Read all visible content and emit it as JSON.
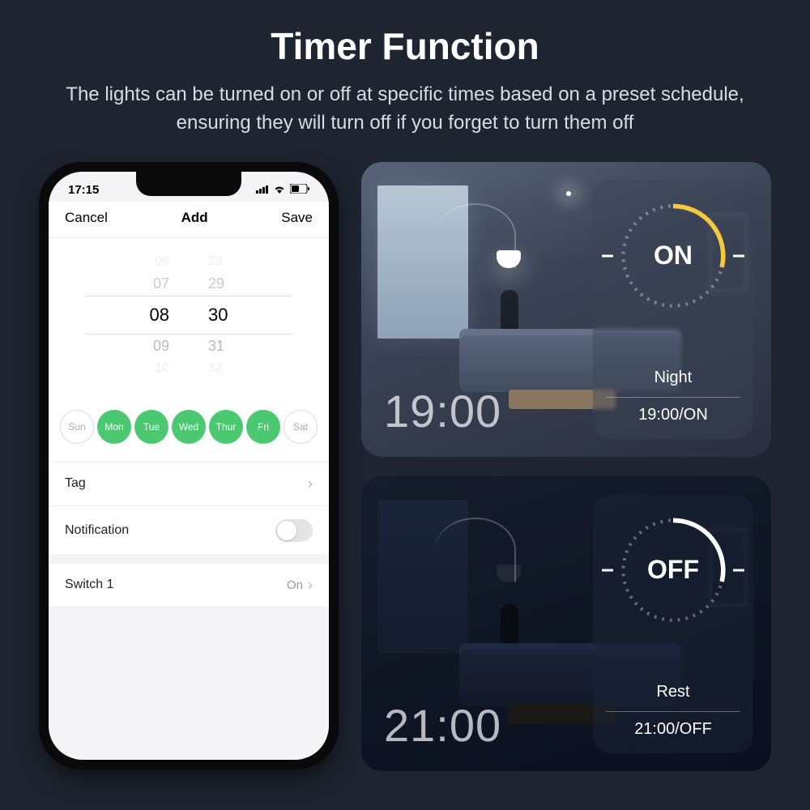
{
  "header": {
    "title": "Timer Function",
    "subtitle": "The lights can be turned on or off at specific times based on a preset schedule, ensuring they will turn off if you forget to turn them off"
  },
  "phone": {
    "status_time": "17:15",
    "nav": {
      "left": "Cancel",
      "center": "Add",
      "right": "Save"
    },
    "picker": {
      "rows": [
        {
          "h": "06",
          "m": "28"
        },
        {
          "h": "07",
          "m": "29"
        },
        {
          "h": "08",
          "m": "30"
        },
        {
          "h": "09",
          "m": "31"
        },
        {
          "h": "10",
          "m": "32"
        }
      ]
    },
    "days": [
      {
        "label": "Sun",
        "on": false
      },
      {
        "label": "Mon",
        "on": true
      },
      {
        "label": "Tue",
        "on": true
      },
      {
        "label": "Wed",
        "on": true
      },
      {
        "label": "Thur",
        "on": true
      },
      {
        "label": "Fri",
        "on": true
      },
      {
        "label": "Sat",
        "on": false
      }
    ],
    "rows": {
      "tag_label": "Tag",
      "notification_label": "Notification",
      "notification_on": false,
      "switch_label": "Switch 1",
      "switch_value": "On"
    }
  },
  "panels": {
    "on": {
      "big_time": "19:00",
      "dial_label": "ON",
      "sub": "Night",
      "detail": "19:00/ON"
    },
    "off": {
      "big_time": "21:00",
      "dial_label": "OFF",
      "sub": "Rest",
      "detail": "21:00/OFF"
    }
  }
}
